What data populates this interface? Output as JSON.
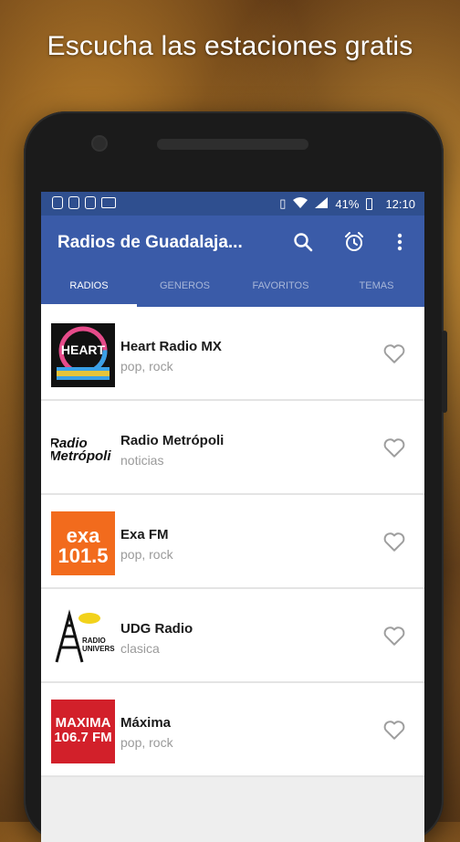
{
  "promo": {
    "headline": "Escucha las estaciones gratis"
  },
  "status_bar": {
    "battery": "41%",
    "time": "12:10"
  },
  "app_bar": {
    "title": "Radios de Guadalaja..."
  },
  "tabs": [
    {
      "label": "RADIOS",
      "active": true
    },
    {
      "label": "GENEROS",
      "active": false
    },
    {
      "label": "FAVORITOS",
      "active": false
    },
    {
      "label": "TEMAS",
      "active": false
    }
  ],
  "stations": [
    {
      "name": "Heart Radio MX",
      "genre": "pop, rock",
      "logo_text": "HEART",
      "favorite": false
    },
    {
      "name": "Radio Metrópoli",
      "genre": "noticias",
      "logo_text": "Radio Metrópoli",
      "favorite": false
    },
    {
      "name": "Exa FM",
      "genre": "pop, rock",
      "logo_text": "exa 101.5",
      "favorite": false
    },
    {
      "name": "UDG Radio",
      "genre": "clasica",
      "logo_text": "RADIO UNIVERSIDAD",
      "favorite": false
    },
    {
      "name": "Máxima",
      "genre": "pop, rock",
      "logo_text": "MAXIMA 106.7 FM",
      "favorite": false
    }
  ],
  "colors": {
    "status_bar": "#2f4f8f",
    "app_bar": "#3a5ba8",
    "heart_icon": "#9e9e9e"
  }
}
